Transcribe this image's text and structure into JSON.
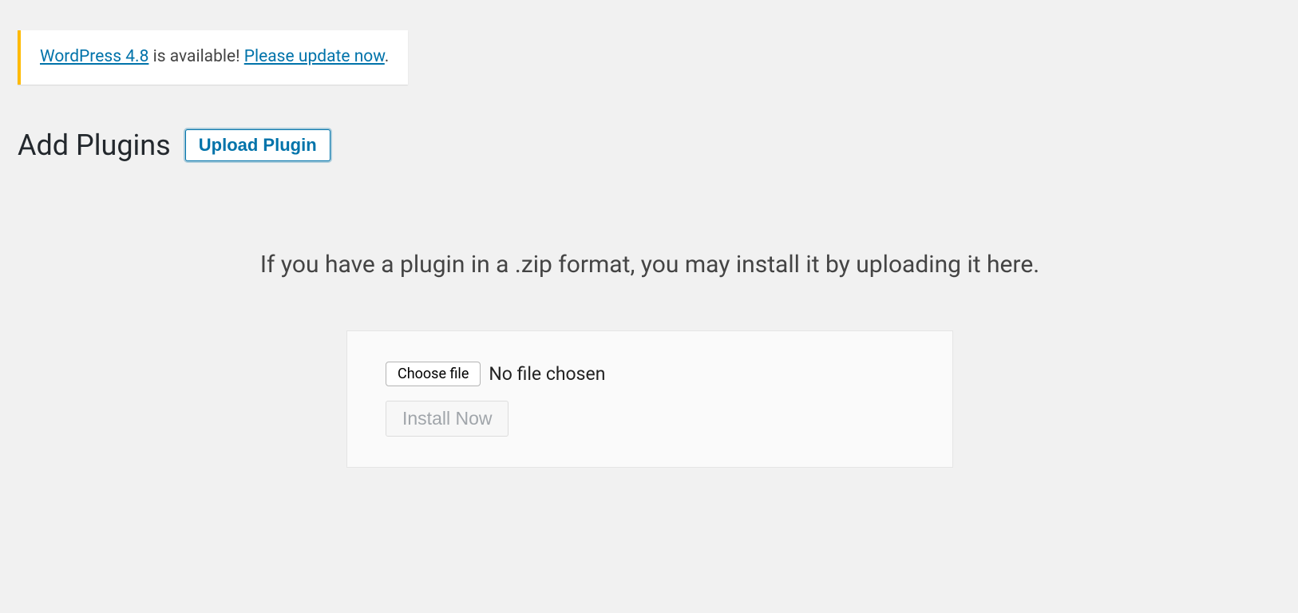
{
  "update_notice": {
    "version_link_text": "WordPress 4.8",
    "middle_text": " is available! ",
    "update_link_text": "Please update now",
    "end_text": "."
  },
  "heading": {
    "title": "Add Plugins",
    "upload_button": "Upload Plugin"
  },
  "upload": {
    "description": "If you have a plugin in a .zip format, you may install it by uploading it here.",
    "choose_file_label": "Choose file",
    "file_status": "No file chosen",
    "install_button": "Install Now"
  }
}
